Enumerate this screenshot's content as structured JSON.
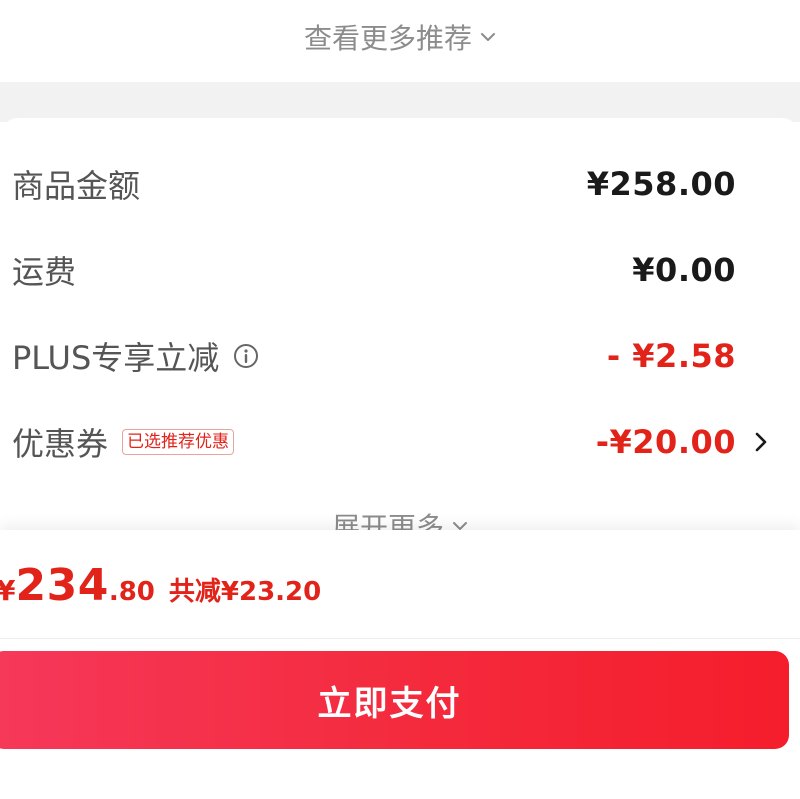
{
  "recommendations": {
    "more_label": "查看更多推荐"
  },
  "summary": {
    "rows": [
      {
        "label": "商品金额",
        "value": "¥258.00"
      },
      {
        "label": "运费",
        "value": "¥0.00"
      },
      {
        "label": "PLUS专享立减",
        "value": "- ¥2.58"
      },
      {
        "label": "优惠券",
        "tag": "已选推荐优惠",
        "value": "-¥20.00"
      }
    ],
    "expand_label": "展开更多"
  },
  "checkout": {
    "currency": "¥",
    "total_integer": "234",
    "total_decimal": ".80",
    "saved_text": "共减¥23.20",
    "pay_label": "立即支付"
  },
  "colors": {
    "accent_red": "#e2231a",
    "button_gradient_start": "#f6385a",
    "button_gradient_end": "#f51d2c"
  },
  "icons": {
    "info": "info-circle-icon",
    "chevron_down": "chevron-down-icon",
    "chevron_right": "chevron-right-icon"
  }
}
